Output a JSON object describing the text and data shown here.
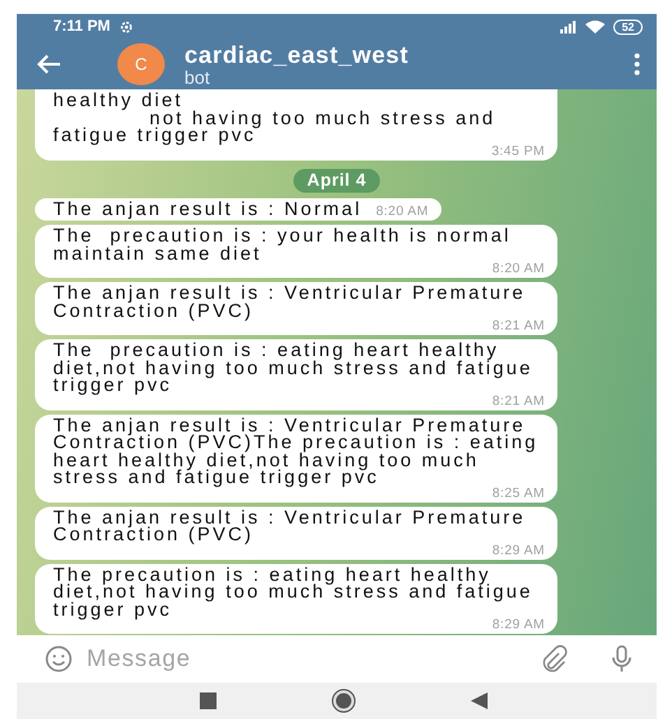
{
  "status_bar": {
    "time": "7:11 PM",
    "battery": "52"
  },
  "header": {
    "avatar_letter": "C",
    "title": "cardiac_east_west",
    "subtitle": "bot"
  },
  "messages": [
    {
      "kind": "message",
      "cut_top": true,
      "text": "healthy diet\n            not having too much stress and fatigue trigger pvc",
      "time": "3:45 PM"
    },
    {
      "kind": "date",
      "text": "April 4"
    },
    {
      "kind": "message",
      "cut_top": false,
      "text": "The anjan result is : Normal",
      "time": "8:20 AM"
    },
    {
      "kind": "message",
      "cut_top": false,
      "text": "The  precaution is : your health is normal maintain same diet",
      "time": "8:20 AM"
    },
    {
      "kind": "message",
      "cut_top": false,
      "text": "The anjan result is : Ventricular Premature Contraction (PVC)",
      "time": "8:21 AM"
    },
    {
      "kind": "message",
      "cut_top": false,
      "text": "The  precaution is : eating heart healthy diet,not having too much stress and fatigue trigger pvc",
      "time": "8:21 AM"
    },
    {
      "kind": "message",
      "cut_top": false,
      "text": "The anjan result is : Ventricular Premature Contraction (PVC)The precaution is : eating heart healthy diet,not having too much stress and fatigue trigger pvc",
      "time": "8:25 AM"
    },
    {
      "kind": "message",
      "cut_top": false,
      "text": "The anjan result is : Ventricular Premature Contraction (PVC)",
      "time": "8:29 AM"
    },
    {
      "kind": "message",
      "cut_top": false,
      "text": "The precaution is : eating heart healthy diet,not having too much stress and fatigue trigger pvc",
      "time": "8:29 AM"
    }
  ],
  "composer": {
    "placeholder": "Message"
  }
}
